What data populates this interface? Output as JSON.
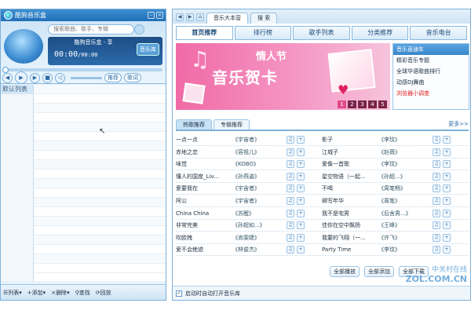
{
  "app_title": "酷狗音乐盒",
  "search_placeholder": "搜索歌曲、歌手、专辑",
  "now_playing": "酷狗音乐盒 - 享",
  "time_current": "00:00",
  "time_total": "/00:00",
  "library_button": "音乐库",
  "btn_recommend": "推荐",
  "btn_lyrics": "歌词",
  "playlist_default": "默认列表",
  "bottom_bar": {
    "list": "列表",
    "add": "添加",
    "remove": "删除",
    "find": "查找",
    "mode": "回放"
  },
  "right_tabs": [
    "音乐大本营",
    "搜 索"
  ],
  "categories": [
    "首页推荐",
    "排行榜",
    "歌手列表",
    "分类推荐",
    "音乐电台"
  ],
  "banner": {
    "title1": "情人节",
    "title2": "音乐贺卡",
    "pages": [
      "1",
      "2",
      "3",
      "4",
      "5"
    ]
  },
  "news": {
    "header": "音乐直通车",
    "items": [
      "精彩音乐专题",
      "全球华语歌曲排行",
      "动感DJ舞曲",
      "浏览器小调查"
    ]
  },
  "hot_tabs": [
    "热歌推荐",
    "专辑推荐"
  ],
  "more_label": "更多>>",
  "songs_left": [
    {
      "title": "一点一点",
      "artist": "《宇宙者》"
    },
    {
      "title": "赤地之恋",
      "artist": "《容祖儿》"
    },
    {
      "title": "味觉",
      "artist": "《KOBO》"
    },
    {
      "title": "懂人的国度_Liv...",
      "artist": "《孙燕姿》"
    },
    {
      "title": "爱要我在",
      "artist": "《宇宙者》"
    },
    {
      "title": "阿公",
      "artist": "《宇宙者》"
    },
    {
      "title": "China China",
      "artist": "《苏醒》"
    },
    {
      "title": "非常完美",
      "artist": "《孙超如...》"
    },
    {
      "title": "吹欧拽",
      "artist": "《尚雯婕》"
    },
    {
      "title": "爱不会绝迹",
      "artist": "《林俊杰》"
    }
  ],
  "songs_right": [
    {
      "title": "影子",
      "artist": "《李玟》"
    },
    {
      "title": "江城子",
      "artist": "《赵薇》"
    },
    {
      "title": "爱像一首歌",
      "artist": "《李玟》"
    },
    {
      "title": "星空物语（一起...",
      "artist": "《孙超...》"
    },
    {
      "title": "不喝",
      "artist": "《周笔畅》"
    },
    {
      "title": "卿写年华",
      "artist": "《周笔》"
    },
    {
      "title": "我不是宅男",
      "artist": "《后舍男...》"
    },
    {
      "title": "佳你在空中飘扬",
      "artist": "《王峰》"
    },
    {
      "title": "我要的飞翔（一...",
      "artist": "《许飞》"
    },
    {
      "title": "Party Time",
      "artist": "《李玟》"
    }
  ],
  "actions": {
    "play_all": "全部播放",
    "add_all": "全部添加",
    "download_all": "全部下载"
  },
  "auto_open_label": "启动时自动打开音乐库",
  "watermark": {
    "line1": "中关村在线",
    "line2": "ZOL.COM.CN"
  }
}
